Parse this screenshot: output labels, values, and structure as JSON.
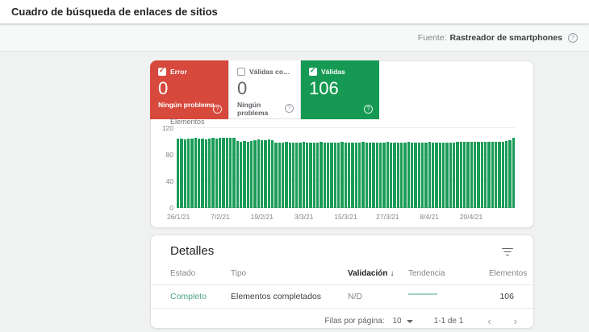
{
  "page": {
    "title": "Cuadro de búsqueda de enlaces de sitios"
  },
  "source_bar": {
    "label": "Fuente:",
    "value": "Rastreador de smartphones",
    "help_icon": "question-circle",
    "text": "?"
  },
  "cards": {
    "error": {
      "label": "Error",
      "count": "0",
      "status": "Ningún problema",
      "checked": true,
      "color": "#d6493c",
      "help_text": "?"
    },
    "warning": {
      "label": "Válidas con adver…",
      "count": "0",
      "status": "Ningún problema",
      "checked": false,
      "color": "#ffffff",
      "help_text": "?"
    },
    "valid": {
      "label": "Válidas",
      "count": "106",
      "status": "",
      "checked": true,
      "color": "#169a53",
      "help_text": "?"
    }
  },
  "chart_data": {
    "type": "bar",
    "title": "Elementos",
    "xlabel": "",
    "ylabel": "Elementos",
    "ylim": [
      0,
      120
    ],
    "yticks": [
      0,
      40,
      80,
      120
    ],
    "grid": true,
    "legend_position": "none",
    "xtick_labels": [
      "26/1/21",
      "7/2/21",
      "19/2/21",
      "3/3/21",
      "15/3/21",
      "27/3/21",
      "8/4/21",
      "20/4/21"
    ],
    "xtick_interval_bars": 12,
    "series": [
      {
        "name": "Válidas",
        "color": "#1a9c57",
        "values": [
          104,
          104,
          103,
          104,
          104,
          105,
          104,
          104,
          103,
          104,
          105,
          104,
          105,
          106,
          105,
          106,
          105,
          101,
          100,
          101,
          100,
          101,
          102,
          103,
          102,
          102,
          103,
          102,
          98,
          98,
          98,
          99,
          98,
          98,
          98,
          98,
          99,
          98,
          98,
          98,
          98,
          99,
          98,
          98,
          98,
          98,
          98,
          99,
          98,
          98,
          98,
          98,
          98,
          99,
          98,
          98,
          98,
          98,
          98,
          98,
          99,
          98,
          98,
          98,
          98,
          98,
          99,
          98,
          98,
          98,
          98,
          98,
          99,
          98,
          98,
          98,
          98,
          98,
          98,
          98,
          100,
          100,
          100,
          100,
          100,
          100,
          100,
          100,
          100,
          100,
          100,
          99,
          99,
          100,
          101,
          102,
          106
        ]
      }
    ]
  },
  "details": {
    "title": "Detalles",
    "filter_icon": "filter-icon",
    "columns": [
      "Estado",
      "Tipo",
      "Validación",
      "Tendencia",
      "Elementos"
    ],
    "sort": {
      "column": "Validación",
      "direction": "desc",
      "arrow": "↓"
    },
    "rows": [
      {
        "estado": "Completo",
        "tipo": "Elementos completados",
        "validacion": "N/D",
        "tendencia": "flat-line",
        "elementos": "106"
      }
    ],
    "pagination": {
      "rows_per_page_label": "Filas por página:",
      "rows_per_page": "10",
      "range": "1-1 de 1",
      "prev": "‹",
      "next": "›"
    }
  }
}
